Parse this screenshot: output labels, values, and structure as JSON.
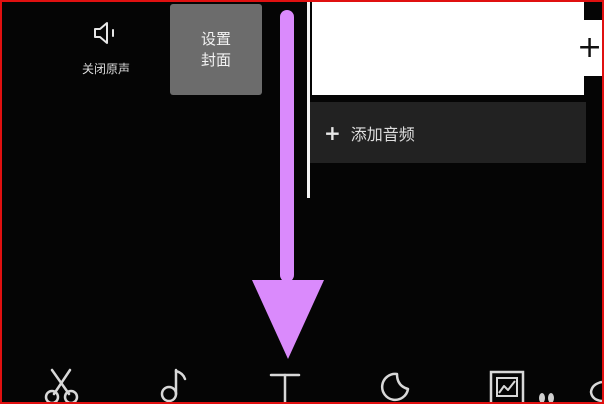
{
  "mute": {
    "label": "关闭原声",
    "icon": "speaker-icon"
  },
  "cover": {
    "line1": "设置",
    "line2": "封面"
  },
  "timeline": {
    "add_audio_label": "添加音频",
    "add_clip_symbol": "+"
  },
  "annotation": {
    "arrow_color": "#da8afc",
    "frame_color": "#e01010"
  },
  "toolbar": {
    "tools": [
      "scissors-icon",
      "music-note-icon",
      "text-icon",
      "sticker-icon",
      "image-icon"
    ]
  }
}
